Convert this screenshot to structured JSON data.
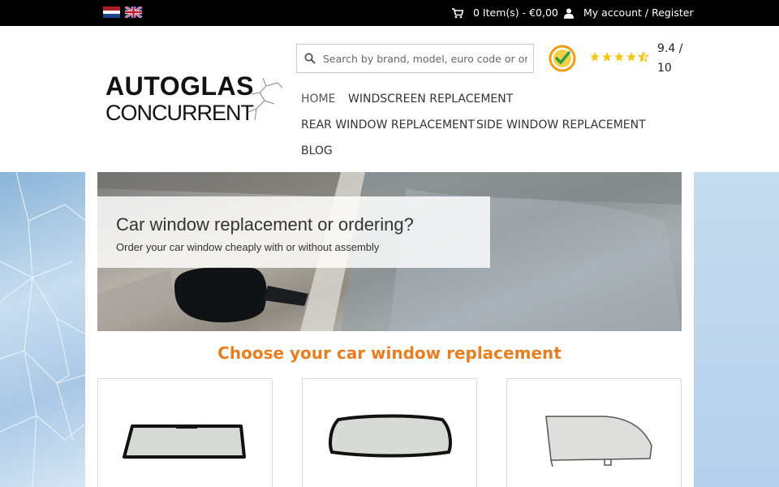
{
  "topbar": {
    "languages": [
      "Nederlands",
      "English"
    ],
    "cart_label": "0 Item(s) - €0,00",
    "account_label": "My account / Register",
    "cart_icon": "cart-icon",
    "account_icon": "user-icon"
  },
  "logo": {
    "line1": "AUTOGLAS",
    "line2": "CONCURRENT"
  },
  "search": {
    "placeholder": "Search by brand, model, euro code or original number",
    "value": ""
  },
  "review": {
    "rating": "9.4 / 10",
    "stars": 4.5
  },
  "nav": {
    "items": [
      {
        "label": "HOME",
        "active": true
      },
      {
        "label": "WINDSCREEN REPLACEMENT"
      },
      {
        "label": "REAR WINDOW REPLACEMENT"
      },
      {
        "label": "SIDE WINDOW REPLACEMENT"
      },
      {
        "label": "BLOG"
      }
    ]
  },
  "banner": {
    "title": "Car window replacement or ordering?",
    "subtitle": "Order your car window cheaply with or without assembly"
  },
  "section": {
    "title": "Choose your car window replacement"
  },
  "colors": {
    "accent": "#e67e22",
    "topbar": "#000000",
    "star": "#f5c518"
  }
}
